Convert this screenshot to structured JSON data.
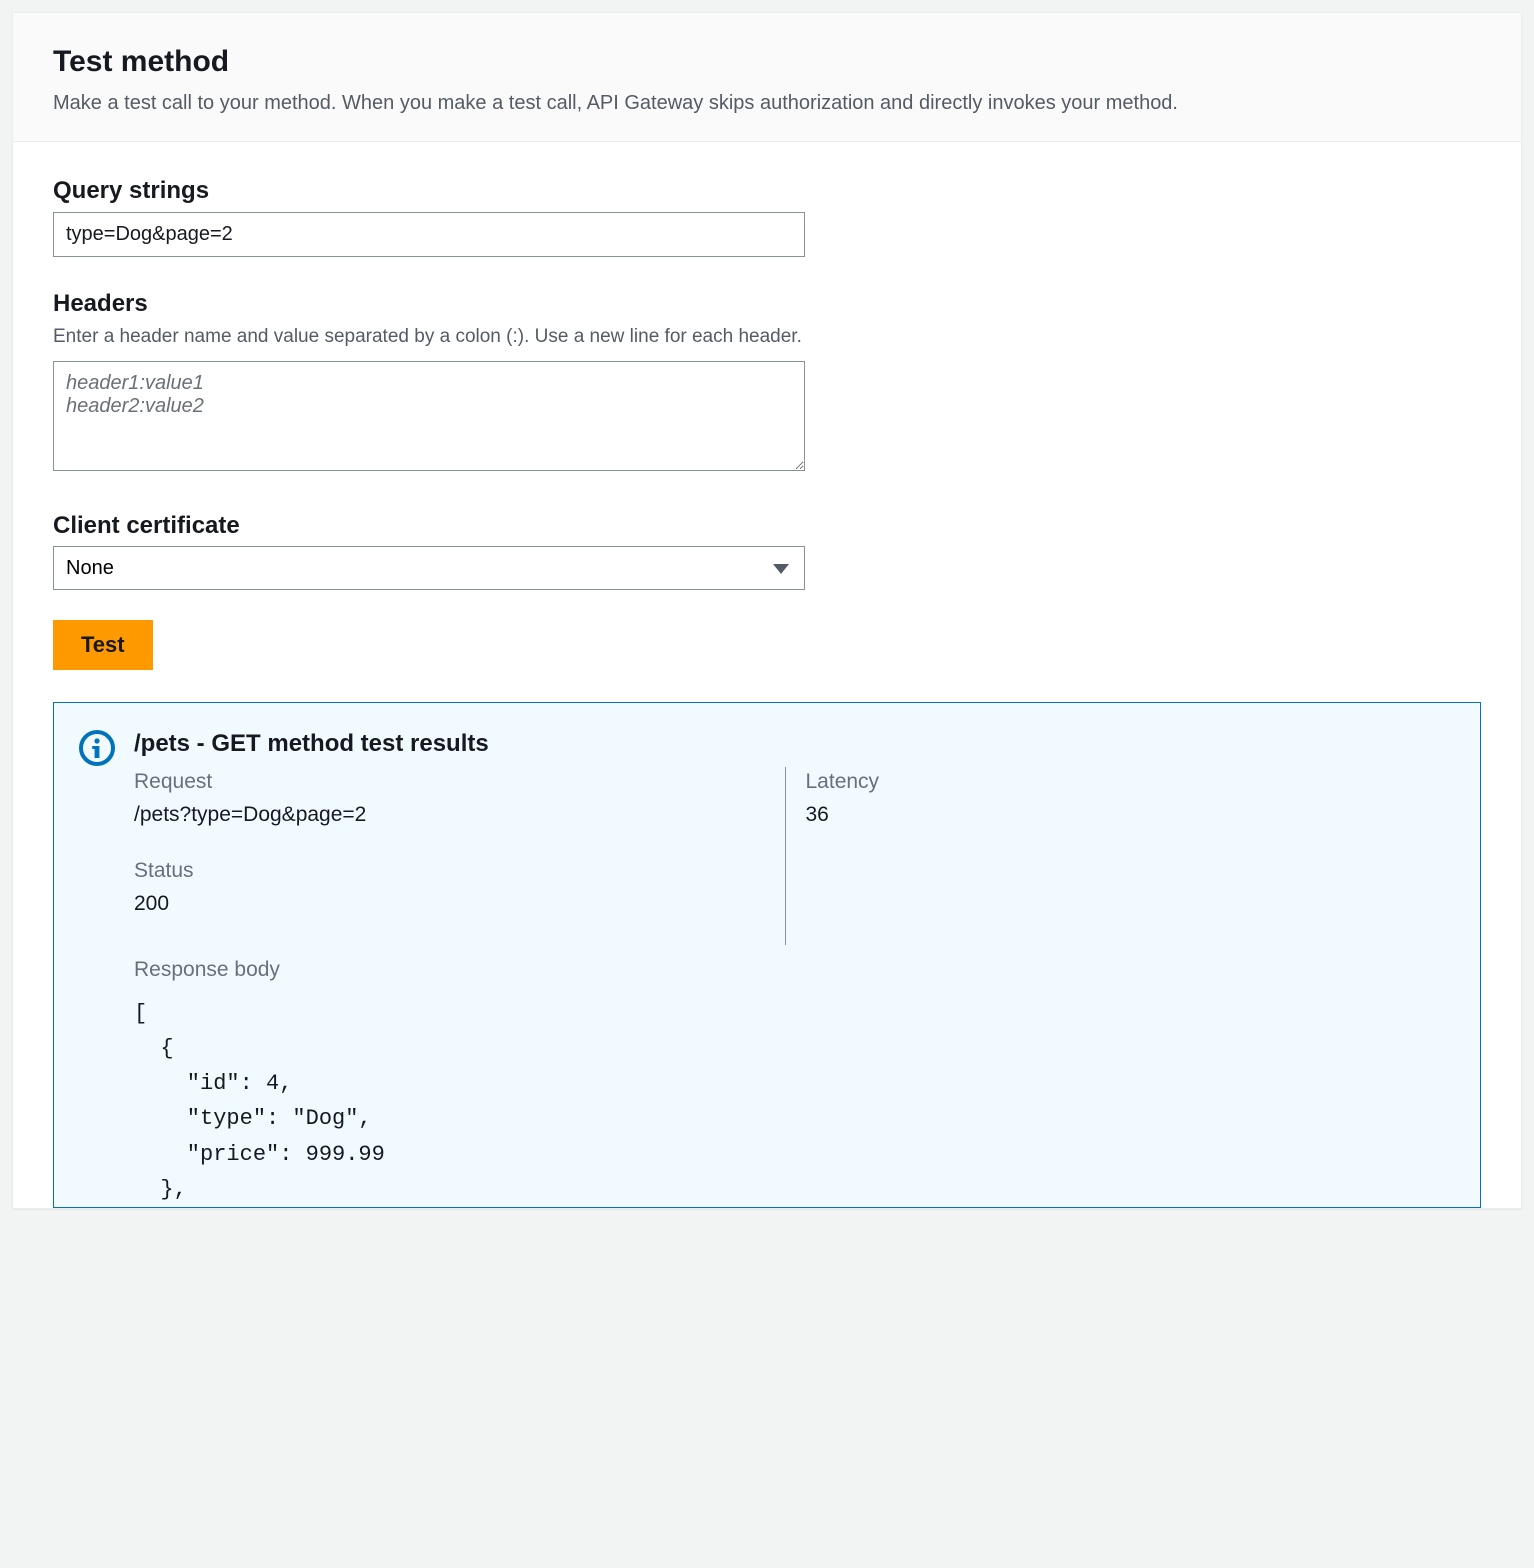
{
  "header": {
    "title": "Test method",
    "description": "Make a test call to your method. When you make a test call, API Gateway skips authorization and directly invokes your method."
  },
  "form": {
    "query_strings": {
      "label": "Query strings",
      "value": "type=Dog&page=2"
    },
    "headers": {
      "label": "Headers",
      "hint": "Enter a header name and value separated by a colon (:). Use a new line for each header.",
      "placeholder": "header1:value1\nheader2:value2"
    },
    "client_certificate": {
      "label": "Client certificate",
      "selected": "None"
    },
    "test_button": "Test"
  },
  "results": {
    "title": "/pets - GET method test results",
    "request_label": "Request",
    "request_value": "/pets?type=Dog&page=2",
    "latency_label": "Latency",
    "latency_value": "36",
    "status_label": "Status",
    "status_value": "200",
    "response_body_label": "Response body",
    "response_body": "[\n  {\n    \"id\": 4,\n    \"type\": \"Dog\",\n    \"price\": 999.99\n  },"
  }
}
